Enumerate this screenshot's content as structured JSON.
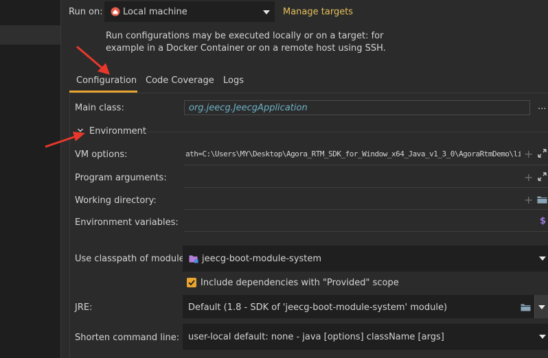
{
  "run_on": {
    "label": "Run on:",
    "value": "Local machine",
    "manage_targets": "Manage targets",
    "description_line1": "Run configurations may be executed locally or on a target: for",
    "description_line2": "example in a Docker Container or on a remote host using SSH."
  },
  "tabs": [
    {
      "label": "Configuration",
      "active": true
    },
    {
      "label": "Code Coverage",
      "active": false
    },
    {
      "label": "Logs",
      "active": false
    }
  ],
  "main_class": {
    "label": "Main class:",
    "value": "org.jeecg.JeecgApplication",
    "more": "..."
  },
  "environment": {
    "label": "Environment",
    "expanded": true
  },
  "vm_options": {
    "label": "VM options:",
    "value": "ath=C:\\Users\\MY\\Desktop\\Agora_RTM_SDK_for_Window_x64_Java_v1_3_0\\AgoraRtmDemo\\lib"
  },
  "program_arguments": {
    "label": "Program arguments:",
    "value": ""
  },
  "working_directory": {
    "label": "Working directory:",
    "value": ""
  },
  "environment_variables": {
    "label": "Environment variables:",
    "value": "",
    "icon_glyph": "$"
  },
  "classpath_module": {
    "label": "Use classpath of module:",
    "value": "jeecg-boot-module-system"
  },
  "include_dependencies": {
    "label": "Include dependencies with \"Provided\" scope",
    "checked": true
  },
  "jre": {
    "label": "JRE:",
    "value": "Default (1.8 - SDK of 'jeecg-boot-module-system' module)"
  },
  "shorten_command_line": {
    "label": "Shorten command line:",
    "value": "user-local default: none - java [options] className [args]"
  },
  "colors": {
    "accent": "#e8a530",
    "link": "#e8c05a",
    "italic_value": "#6fb3c8",
    "annotation_red": "#e8382c",
    "env_icon": "#9a7ae0",
    "folder_icon": "#8aa4b8",
    "module_icon": "#b57fd9"
  }
}
